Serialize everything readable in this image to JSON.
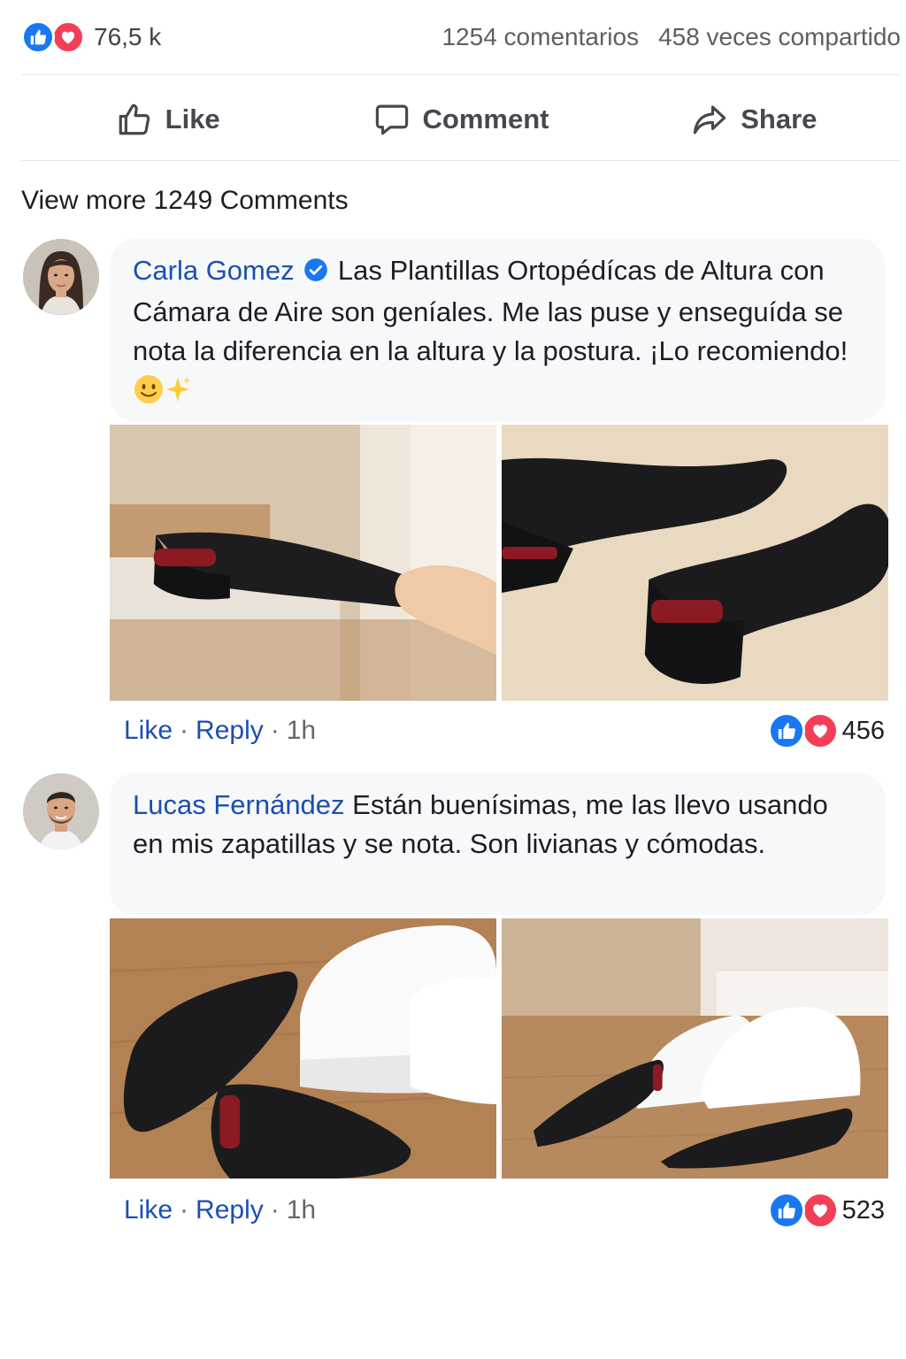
{
  "post_stats": {
    "reaction_count": "76,5 k",
    "comments": "1254 comentarios",
    "shares": "458 veces compartido"
  },
  "actions": {
    "like": "Like",
    "comment": "Comment",
    "share": "Share"
  },
  "view_more": "View more 1249 Comments",
  "comments": [
    {
      "author": "Carla Gomez",
      "verified": true,
      "text": "Las Plantillas Ortopédícas de Altura con Cámara de Aire son geníales. Me las puse y enseguída se nota la diferencia en la altura y la postura. ¡Lo recomiendo!",
      "emojis": [
        "slightly-smiling-face",
        "sparkles"
      ],
      "like_label": "Like",
      "reply_label": "Reply",
      "time": "1h",
      "reaction_count": "456"
    },
    {
      "author": "Lucas Fernández",
      "verified": false,
      "text": "Están buenísimas, me las llevo usando en mis zapatillas y se nota. Son livianas y cómodas.",
      "like_label": "Like",
      "reply_label": "Reply",
      "time": "1h",
      "reaction_count": "523"
    }
  ],
  "colors": {
    "like_blue": "#1877f2",
    "love_red": "#f33e58",
    "author_link": "#1c4fb0",
    "bubble_bg": "#f7f8fa"
  }
}
